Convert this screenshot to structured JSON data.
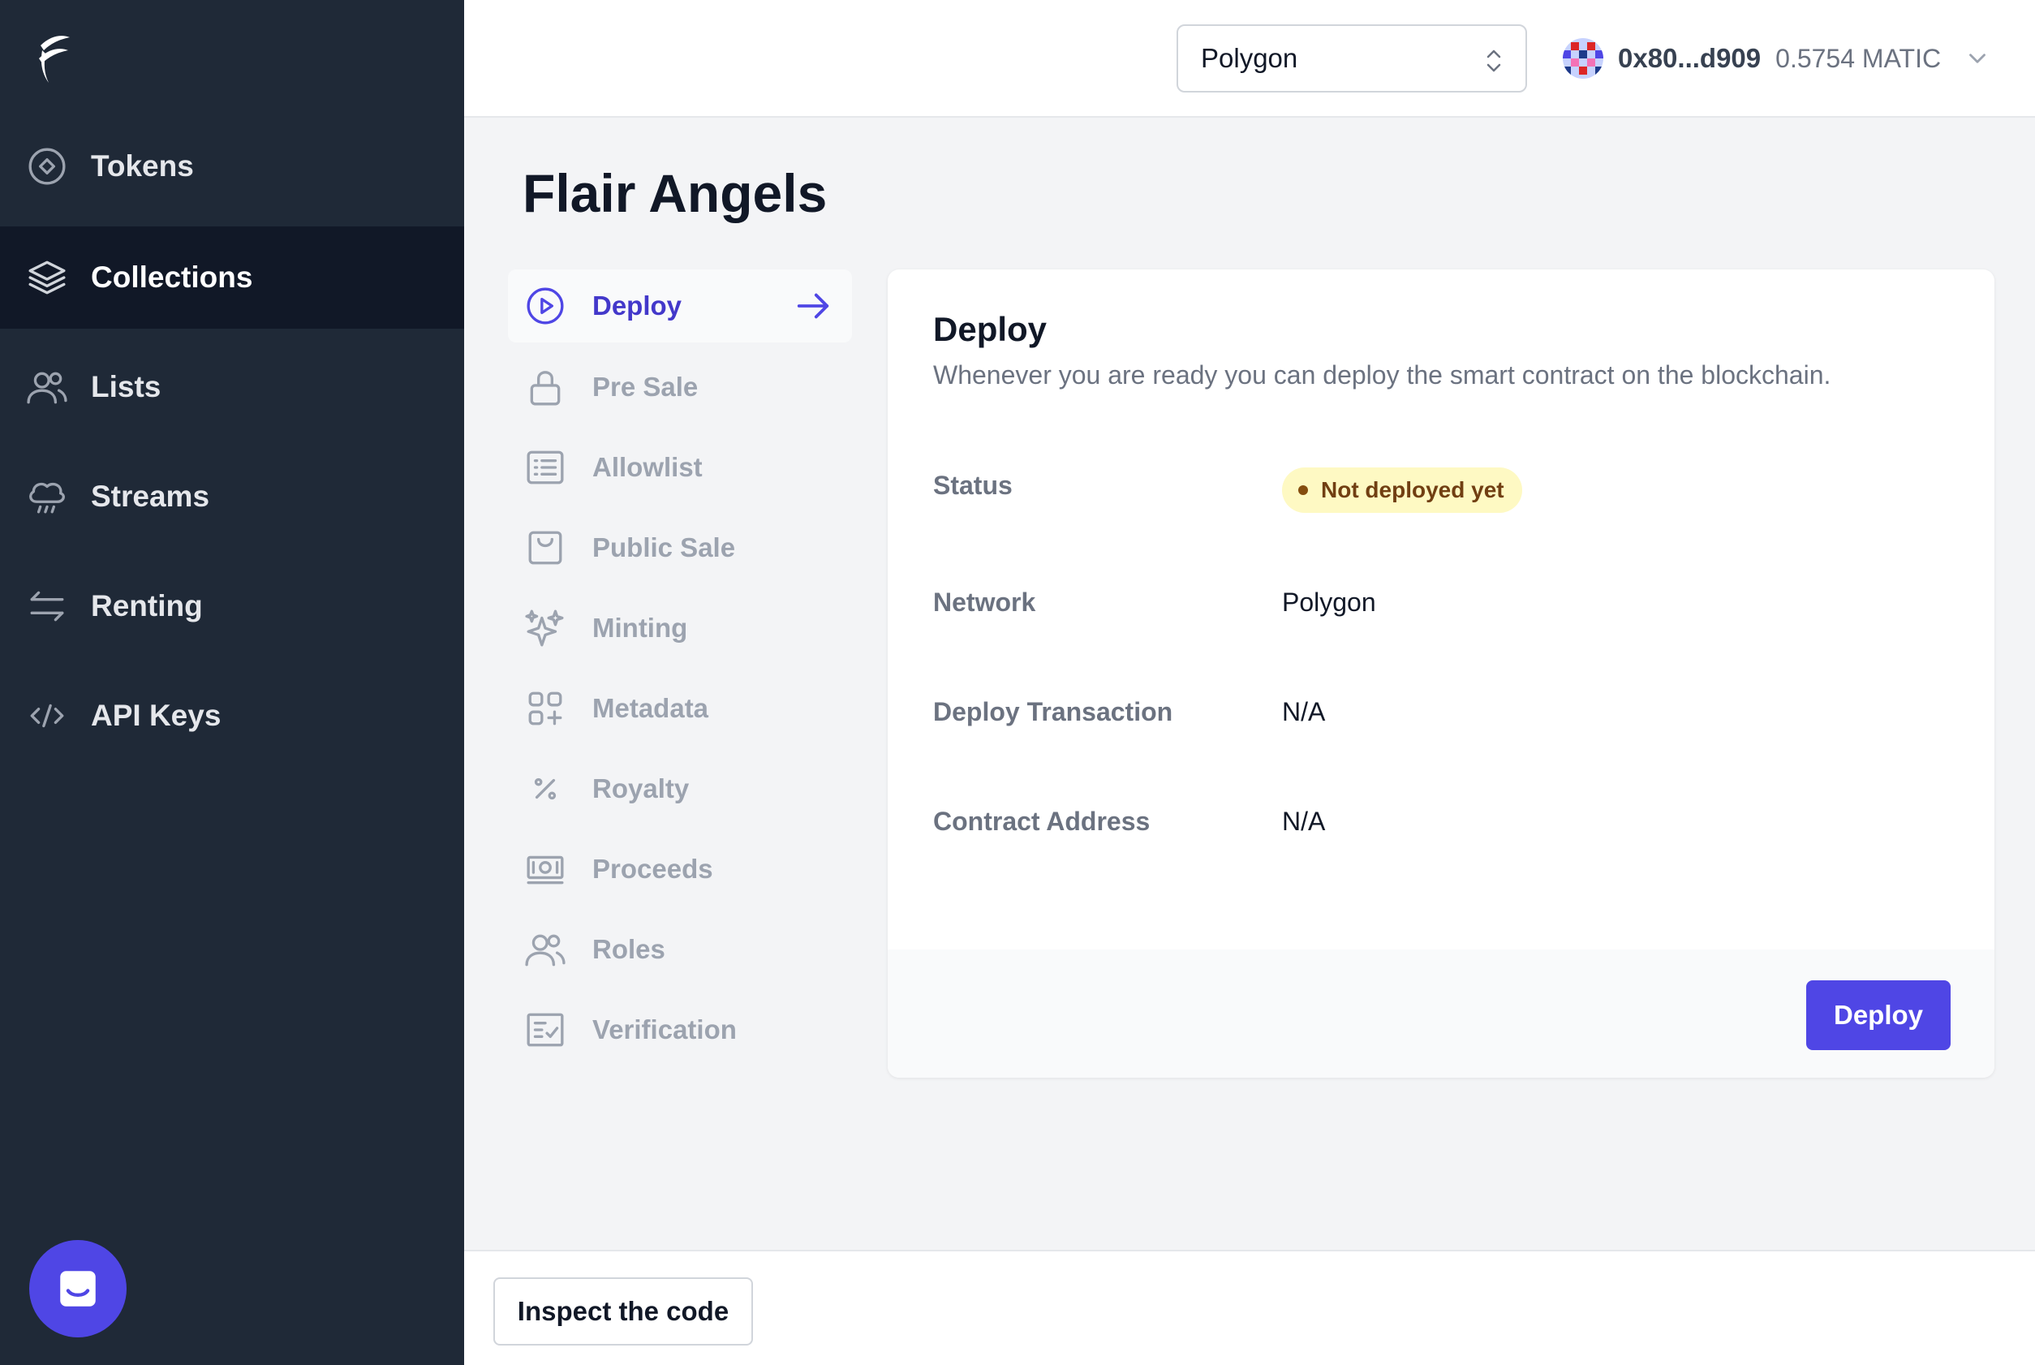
{
  "sidebar": {
    "items": [
      {
        "label": "Tokens",
        "icon": "token-icon"
      },
      {
        "label": "Collections",
        "icon": "stack-icon"
      },
      {
        "label": "Lists",
        "icon": "users-icon"
      },
      {
        "label": "Streams",
        "icon": "cloud-rain-icon"
      },
      {
        "label": "Renting",
        "icon": "switch-arrows-icon"
      },
      {
        "label": "API Keys",
        "icon": "code-icon"
      }
    ],
    "active": "Collections"
  },
  "topbar": {
    "network": "Polygon",
    "wallet_address": "0x80...d909",
    "wallet_balance": "0.5754 MATIC"
  },
  "page": {
    "title": "Flair Angels"
  },
  "subnav": {
    "items": [
      {
        "label": "Deploy",
        "icon": "play-circle-icon"
      },
      {
        "label": "Pre Sale",
        "icon": "lock-icon"
      },
      {
        "label": "Allowlist",
        "icon": "list-icon"
      },
      {
        "label": "Public Sale",
        "icon": "shopping-bag-icon"
      },
      {
        "label": "Minting",
        "icon": "sparkles-icon"
      },
      {
        "label": "Metadata",
        "icon": "grid-plus-icon"
      },
      {
        "label": "Royalty",
        "icon": "percent-icon"
      },
      {
        "label": "Proceeds",
        "icon": "cash-icon"
      },
      {
        "label": "Roles",
        "icon": "users-icon"
      },
      {
        "label": "Verification",
        "icon": "checklist-icon"
      }
    ],
    "active": "Deploy"
  },
  "card": {
    "title": "Deploy",
    "description": "Whenever you are ready you can deploy the smart contract on the blockchain.",
    "rows": [
      {
        "label": "Status",
        "value": "Not deployed yet"
      },
      {
        "label": "Network",
        "value": "Polygon"
      },
      {
        "label": "Deploy Transaction",
        "value": "N/A"
      },
      {
        "label": "Contract Address",
        "value": "N/A"
      }
    ],
    "button": "Deploy"
  },
  "footer": {
    "inspect_button": "Inspect the code"
  },
  "colors": {
    "sidebar_bg": "#1f2937",
    "sidebar_active": "#111827",
    "accent": "#4f46e5",
    "badge_bg": "#fef9c3",
    "badge_text": "#713f12"
  }
}
